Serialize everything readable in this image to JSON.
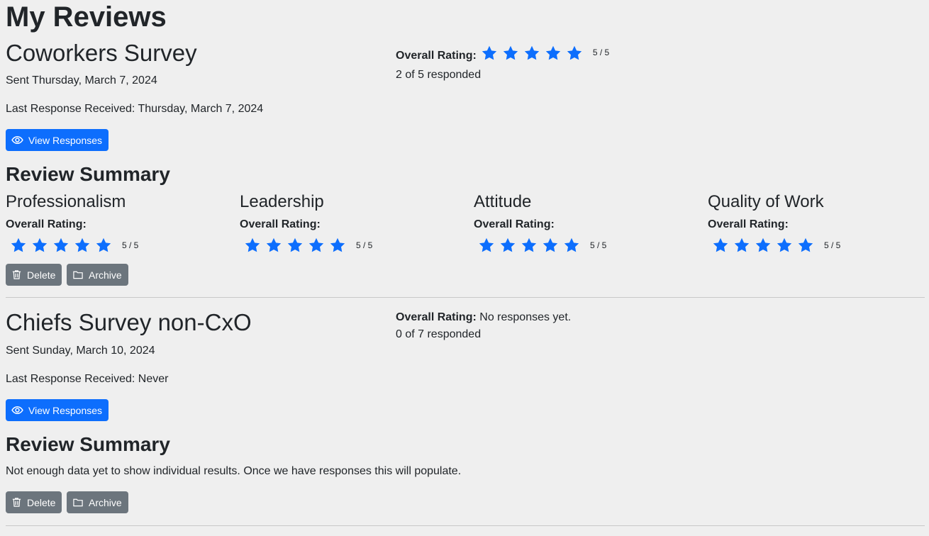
{
  "page": {
    "title": "My Reviews"
  },
  "colors": {
    "accent": "#0d6efd",
    "secondary": "#6c757d",
    "star": "#0d6efd",
    "background": "#efefef"
  },
  "surveys": [
    {
      "title": "Coworkers Survey",
      "sent": "Sent Thursday, March 7, 2024",
      "last_response": "Last Response Received: Thursday, March 7, 2024",
      "view_button": "View Responses",
      "overall_label": "Overall Rating:",
      "overall_stars": 5,
      "overall_score": "5 / 5",
      "responded": "2 of 5 responded",
      "summary_title": "Review Summary",
      "categories": [
        {
          "name": "Professionalism",
          "rating_label": "Overall Rating:",
          "stars": 5,
          "score": "5 / 5"
        },
        {
          "name": "Leadership",
          "rating_label": "Overall Rating:",
          "stars": 5,
          "score": "5 / 5"
        },
        {
          "name": "Attitude",
          "rating_label": "Overall Rating:",
          "stars": 5,
          "score": "5 / 5"
        },
        {
          "name": "Quality of Work",
          "rating_label": "Overall Rating:",
          "stars": 5,
          "score": "5 / 5"
        }
      ],
      "delete_button": "Delete",
      "archive_button": "Archive"
    },
    {
      "title": "Chiefs Survey non-CxO",
      "sent": "Sent Sunday, March 10, 2024",
      "last_response": "Last Response Received: Never",
      "view_button": "View Responses",
      "overall_label": "Overall Rating:",
      "overall_value": "No responses yet.",
      "responded": "0 of 7 responded",
      "summary_title": "Review Summary",
      "summary_text": "Not enough data yet to show individual results. Once we have responses this will populate.",
      "delete_button": "Delete",
      "archive_button": "Archive"
    }
  ],
  "icons": {
    "view": "eye-icon",
    "delete": "trash-icon",
    "archive": "folder-icon",
    "star": "star-icon"
  }
}
